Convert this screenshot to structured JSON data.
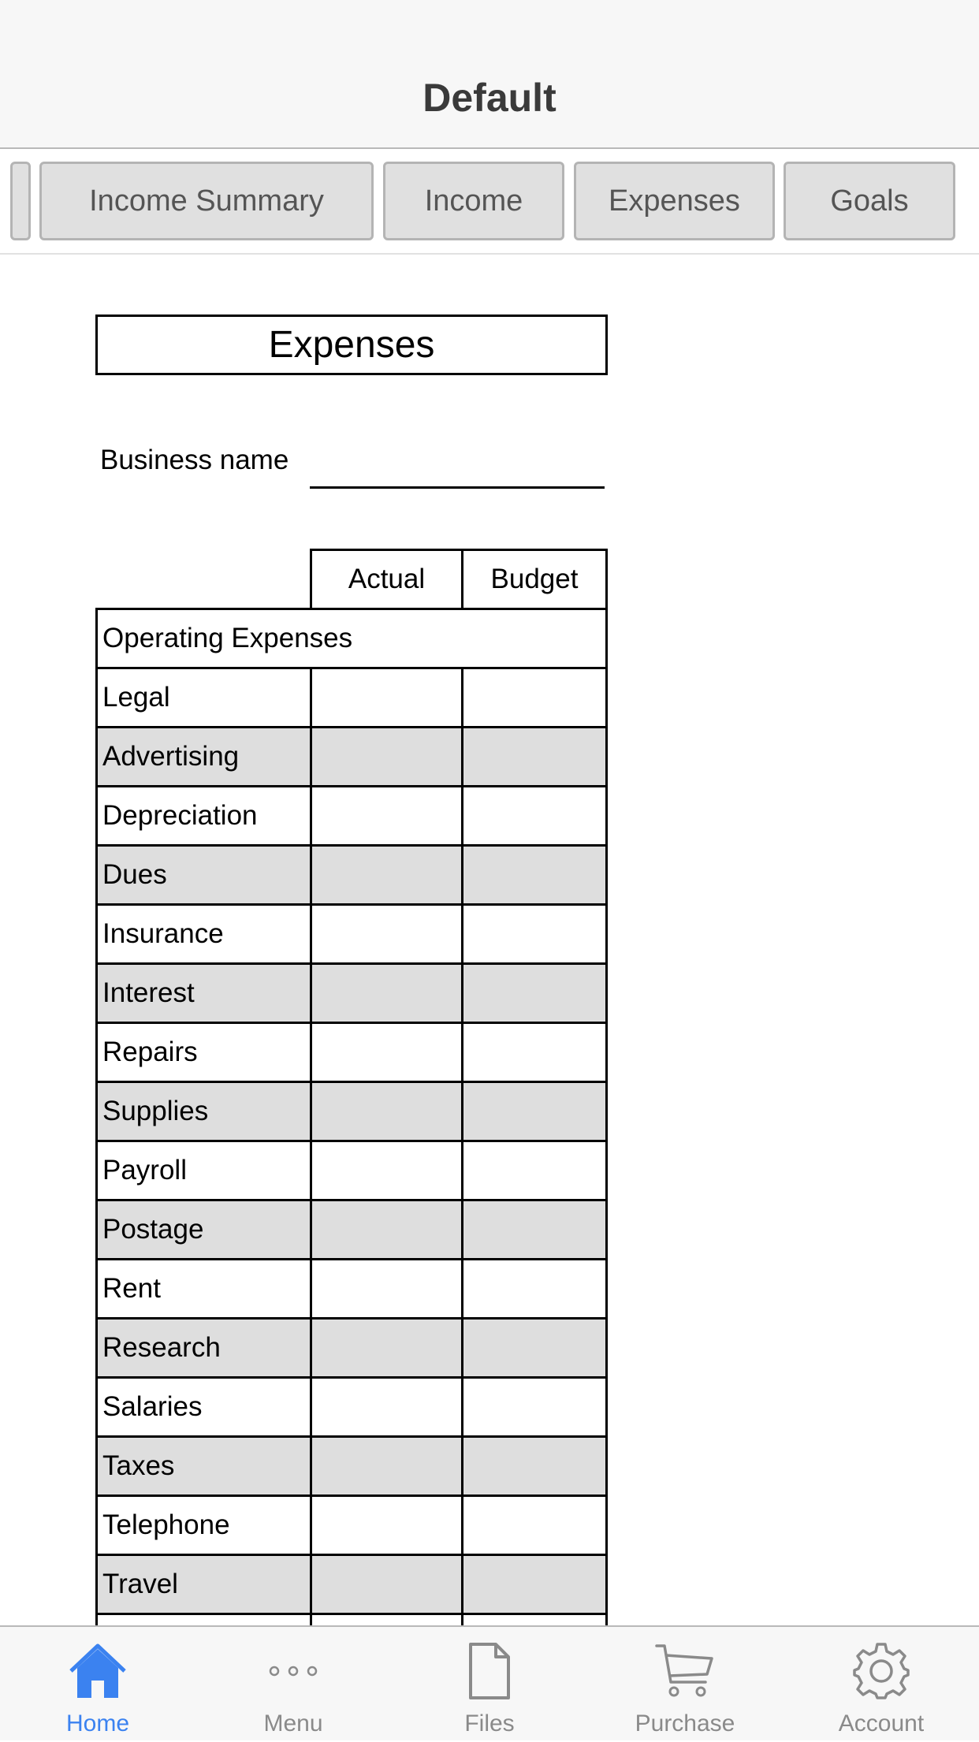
{
  "header": {
    "title": "Default"
  },
  "tabs": [
    "Income Summary",
    "Income",
    "Expenses",
    "Goals"
  ],
  "sheet": {
    "title": "Expenses",
    "business_name_label": "Business name",
    "business_name_value": "",
    "columns": [
      "Actual",
      "Budget"
    ],
    "section": "Operating Expenses",
    "rows": [
      "Legal",
      "Advertising",
      "Depreciation",
      "Dues",
      "Insurance",
      "Interest",
      "Repairs",
      "Supplies",
      "Payroll",
      "Postage",
      "Rent",
      "Research",
      "Salaries",
      "Taxes",
      "Telephone",
      "Travel"
    ]
  },
  "tab_bar": [
    {
      "label": "Home",
      "icon": "home-icon",
      "active": true
    },
    {
      "label": "Menu",
      "icon": "more-icon",
      "active": false
    },
    {
      "label": "Files",
      "icon": "file-icon",
      "active": false
    },
    {
      "label": "Purchase",
      "icon": "cart-icon",
      "active": false
    },
    {
      "label": "Account",
      "icon": "gear-icon",
      "active": false
    }
  ],
  "colors": {
    "accent": "#3b82f0",
    "shaded_row": "#dedede",
    "tab_bg": "#e0e0e0"
  }
}
